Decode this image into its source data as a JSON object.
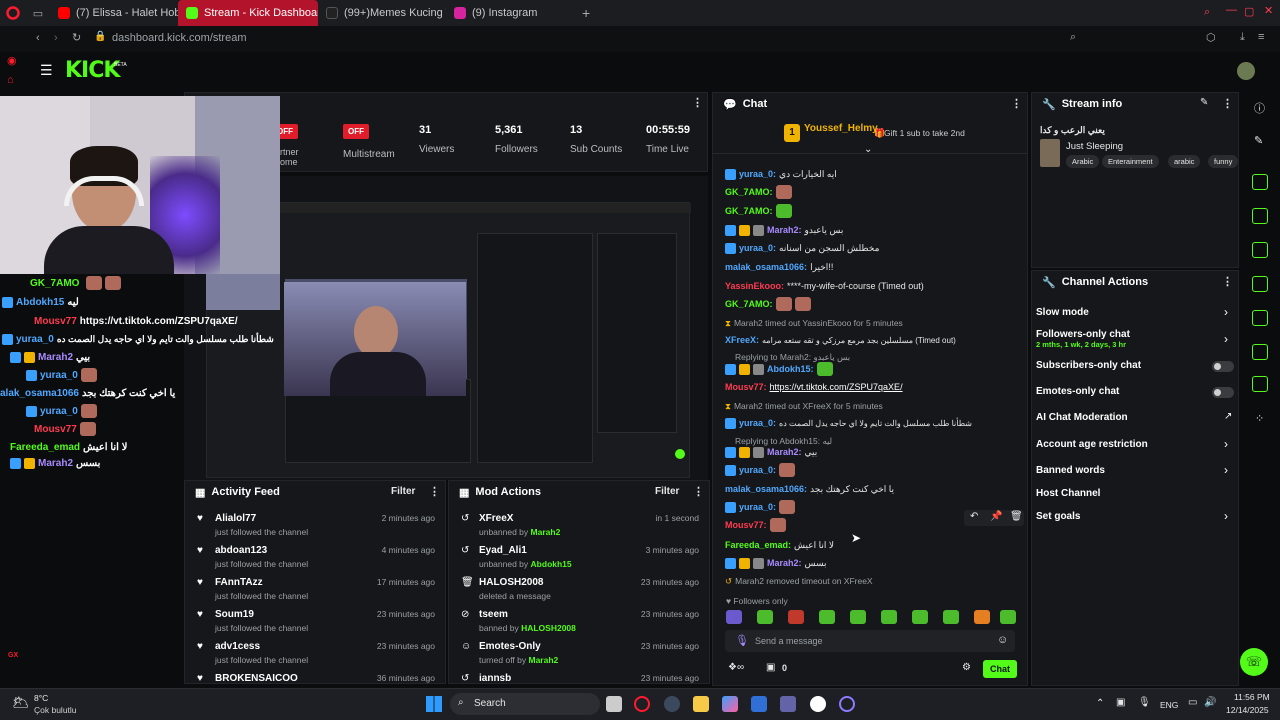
{
  "browser": {
    "tabs": [
      {
        "label": "(7) Elissa - Halet Hob | Ly"
      },
      {
        "label": "Stream - Kick Dashboard"
      },
      {
        "label": "(99+)Memes Kucing Terk"
      },
      {
        "label": "(9) Instagram"
      }
    ],
    "url": "dashboard.kick.com/stream"
  },
  "brand": {
    "logo": "KICK",
    "beta": "BETA",
    "accent": "#53fc18"
  },
  "stats": [
    {
      "value": "OFF",
      "label": "Partner Home"
    },
    {
      "value": "OFF",
      "label": "Multistream"
    },
    {
      "value": "31",
      "label": "Viewers"
    },
    {
      "value": "5,361",
      "label": "Followers"
    },
    {
      "value": "13",
      "label": "Sub Counts"
    },
    {
      "value": "00:55:59",
      "label": "Time Live"
    }
  ],
  "stats_partial_label1": "rtner",
  "stats_partial_label2": "ome",
  "activity_feed": {
    "title": "Activity Feed",
    "filter": "Filter",
    "items": [
      {
        "name": "Alialol77",
        "sub": "just followed the channel",
        "time": "2 minutes ago"
      },
      {
        "name": "abdoan123",
        "sub": "just followed the channel",
        "time": "4 minutes ago"
      },
      {
        "name": "FAnnTAzz",
        "sub": "just followed the channel",
        "time": "17 minutes ago"
      },
      {
        "name": "Soum19",
        "sub": "just followed the channel",
        "time": "23 minutes ago"
      },
      {
        "name": "adv1cess",
        "sub": "just followed the channel",
        "time": "23 minutes ago"
      },
      {
        "name": "BROKENSAICOO",
        "sub": "",
        "time": "36 minutes ago"
      }
    ]
  },
  "mod_actions": {
    "title": "Mod Actions",
    "filter": "Filter",
    "items": [
      {
        "name": "XFreeX",
        "sub_prefix": "unbanned by",
        "by": "Marah2",
        "time": "in 1 second"
      },
      {
        "name": "Eyad_Ali1",
        "sub_prefix": "unbanned by",
        "by": "Abdokh15",
        "time": "3 minutes ago"
      },
      {
        "name": "HALOSH2008",
        "sub_prefix": "deleted a message",
        "by": "",
        "time": "23 minutes ago"
      },
      {
        "name": "tseem",
        "sub_prefix": "banned by",
        "by": "HALOSH2008",
        "time": "23 minutes ago"
      },
      {
        "name": "Emotes-Only",
        "sub_prefix": "turned off by",
        "by": "Marah2",
        "time": "23 minutes ago"
      },
      {
        "name": "iannsb",
        "sub_prefix": "",
        "by": "",
        "time": "23 minutes ago"
      }
    ]
  },
  "chat": {
    "title": "Chat",
    "pinned_user": "Youssef_Helmy",
    "pinned_count": "1",
    "gift_text": "Gift 1 sub to take 2nd",
    "lines": [
      {
        "user": "yuraa_0:",
        "color": "blue",
        "text": "ايه الخيارات دي"
      },
      {
        "user": "GK_7AMO:",
        "color": "green",
        "text": ""
      },
      {
        "user": "GK_7AMO:",
        "color": "green",
        "text": ""
      },
      {
        "user": "Marah2:",
        "color": "purple",
        "text": "بس ياعبدو"
      },
      {
        "user": "yuraa_0:",
        "color": "blue",
        "text": "مخطلش السجن من اسنانه"
      },
      {
        "user": "malak_osama1066:",
        "color": "blue",
        "text": "اخيرا!!"
      },
      {
        "user": "YassinEkooo:",
        "color": "red",
        "text": "****-my-wife-of-course (Timed out)"
      },
      {
        "user": "GK_7AMO:",
        "color": "green",
        "text": ""
      },
      {
        "user": "",
        "color": "sys",
        "text": "Marah2 timed out YassinEkooo for 5 minutes"
      },
      {
        "user": "XFreeX:",
        "color": "blue",
        "text": "مسلسلين بجد مرمع مرزكي و تقه ستعه مرامه (Timed out)"
      },
      {
        "user": "",
        "color": "sys",
        "text": "Replying to Marah2: بس ياعبدو"
      },
      {
        "user": "Abdokh15:",
        "color": "blue",
        "text": ""
      },
      {
        "user": "Mousv77:",
        "color": "red",
        "text": "https://vt.tiktok.com/ZSPU7qaXE/"
      },
      {
        "user": "",
        "color": "sys",
        "text": "Marah2 timed out XFreeX for 5 minutes"
      },
      {
        "user": "yuraa_0:",
        "color": "blue",
        "text": "شطأنا طلب مسلسل والت تايم ولا اي حاجه يدل الصمت ده"
      },
      {
        "user": "",
        "color": "sys",
        "text": "Replying to Abdokh15: ليه"
      },
      {
        "user": "Marah2:",
        "color": "purple",
        "text": "بيي"
      },
      {
        "user": "yuraa_0:",
        "color": "blue",
        "text": ""
      },
      {
        "user": "malak_osama1066:",
        "color": "blue",
        "text": "يا اخي كنت كرهتك بجد"
      },
      {
        "user": "yuraa_0:",
        "color": "blue",
        "text": ""
      },
      {
        "user": "Mousv77:",
        "color": "red",
        "text": ""
      },
      {
        "user": "Fareeda_emad:",
        "color": "green",
        "text": "لا انا اعيش"
      },
      {
        "user": "Marah2:",
        "color": "purple",
        "text": "بسس"
      },
      {
        "user": "",
        "color": "sys",
        "text": "Marah2 removed timeout on XFreeX"
      }
    ],
    "followers_only": "Followers only",
    "input_placeholder": "Send a message",
    "points": "0",
    "send": "Chat"
  },
  "stream_info": {
    "title": "Stream info",
    "stream_title": "يعني الرعب و كدا",
    "category": "Just Sleeping",
    "tags": [
      "Arabic",
      "Enterainment",
      "arabic",
      "funny"
    ]
  },
  "channel_actions": {
    "title": "Channel Actions",
    "items": [
      {
        "label": "Slow mode",
        "sub": ""
      },
      {
        "label": "Followers-only chat",
        "sub": "2 mths, 1 wk, 2 days, 3 hr"
      },
      {
        "label": "Subscribers-only chat",
        "sub": ""
      },
      {
        "label": "Emotes-only chat",
        "sub": ""
      },
      {
        "label": "AI Chat Moderation",
        "sub": ""
      },
      {
        "label": "Account age restriction",
        "sub": ""
      },
      {
        "label": "Banned words",
        "sub": ""
      },
      {
        "label": "Host Channel",
        "sub": ""
      },
      {
        "label": "Set goals",
        "sub": ""
      }
    ]
  },
  "overlay_chat": [
    {
      "user": "GK_7AMO",
      "color": "green",
      "text": ""
    },
    {
      "user": "Abdokh15",
      "color": "blue",
      "text": "ليه"
    },
    {
      "user": "Mousv77",
      "color": "red",
      "text": "https://vt.tiktok.com/ZSPU7qaXE/"
    },
    {
      "user": "yuraa_0",
      "color": "blue",
      "text": "شطأنا طلب مسلسل والت تايم ولا اي حاجه يدل الصمت ده"
    },
    {
      "user": "Marah2",
      "color": "purple",
      "text": "بيي"
    },
    {
      "user": "yuraa_0",
      "color": "blue",
      "text": ""
    },
    {
      "user": "Mousv77",
      "color": "red",
      "text": ""
    },
    {
      "user": "alak_osama1066",
      "color": "blue",
      "text": "يا اخي كنت كرهتك بجد"
    },
    {
      "user": "yuraa_0",
      "color": "blue",
      "text": ""
    },
    {
      "user": "Mousv77",
      "color": "red",
      "text": ""
    },
    {
      "user": "Fareeda_emad",
      "color": "green",
      "text": "لا انا اعيش"
    },
    {
      "user": "Marah2",
      "color": "purple",
      "text": "بسس"
    }
  ],
  "overlay_gx": "GX",
  "taskbar": {
    "weather_temp": "8°C",
    "weather_text": "Çok bulutlu",
    "search": "Search",
    "lang": "ENG",
    "time": "11:56 PM",
    "date": "12/14/2025"
  }
}
